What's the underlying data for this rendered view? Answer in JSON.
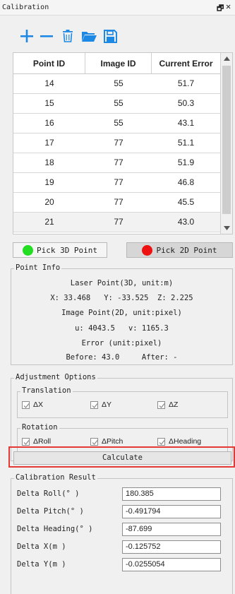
{
  "window": {
    "title": "Calibration"
  },
  "toolbar": {
    "icons": [
      "add-icon",
      "remove-icon",
      "delete-icon",
      "open-folder-icon",
      "save-icon"
    ],
    "accent": "#1e88e5"
  },
  "table": {
    "columns": [
      "Point ID",
      "Image ID",
      "Current Error"
    ],
    "rows": [
      [
        "14",
        "55",
        "51.7"
      ],
      [
        "15",
        "55",
        "50.3"
      ],
      [
        "16",
        "55",
        "43.1"
      ],
      [
        "17",
        "77",
        "51.1"
      ],
      [
        "18",
        "77",
        "51.9"
      ],
      [
        "19",
        "77",
        "46.8"
      ],
      [
        "20",
        "77",
        "45.5"
      ],
      [
        "21",
        "77",
        "43.0"
      ]
    ],
    "selected_row_index": 7
  },
  "pick": {
    "pick3d_label": "Pick 3D Point",
    "pick3d_color": "#22dd22",
    "pick2d_label": "Pick 2D Point",
    "pick2d_color": "#ee1111"
  },
  "point_info": {
    "title": "Point Info",
    "laser_heading": "Laser Point(3D, unit:m)",
    "laser_values": "X: 33.468   Y: -33.525  Z: 2.225",
    "image_heading": "Image Point(2D, unit:pixel)",
    "image_values": "u: 4043.5   v: 1165.3",
    "error_heading": "Error (unit:pixel)",
    "error_values": "Before: 43.0     After: -"
  },
  "adjustment": {
    "title": "Adjustment Options",
    "translation": {
      "title": "Translation",
      "items": [
        {
          "label": "ΔX",
          "checked": true
        },
        {
          "label": "ΔY",
          "checked": true
        },
        {
          "label": "ΔZ",
          "checked": true
        }
      ]
    },
    "rotation": {
      "title": "Rotation",
      "items": [
        {
          "label": "ΔRoll",
          "checked": true
        },
        {
          "label": "ΔPitch",
          "checked": true
        },
        {
          "label": "ΔHeading",
          "checked": true
        }
      ]
    }
  },
  "calculate": {
    "label": "Calculate",
    "highlight_color": "#e53935"
  },
  "result": {
    "title": "Calibration Result",
    "fields": [
      {
        "label": "Delta Roll(° )",
        "value": "180.385"
      },
      {
        "label": "Delta Pitch(° )",
        "value": "-0.491794"
      },
      {
        "label": "Delta Heading(° )",
        "value": "-87.699"
      },
      {
        "label": "Delta X(m )",
        "value": "-0.125752"
      },
      {
        "label": "Delta Y(m )",
        "value": "-0.0255054"
      }
    ]
  }
}
